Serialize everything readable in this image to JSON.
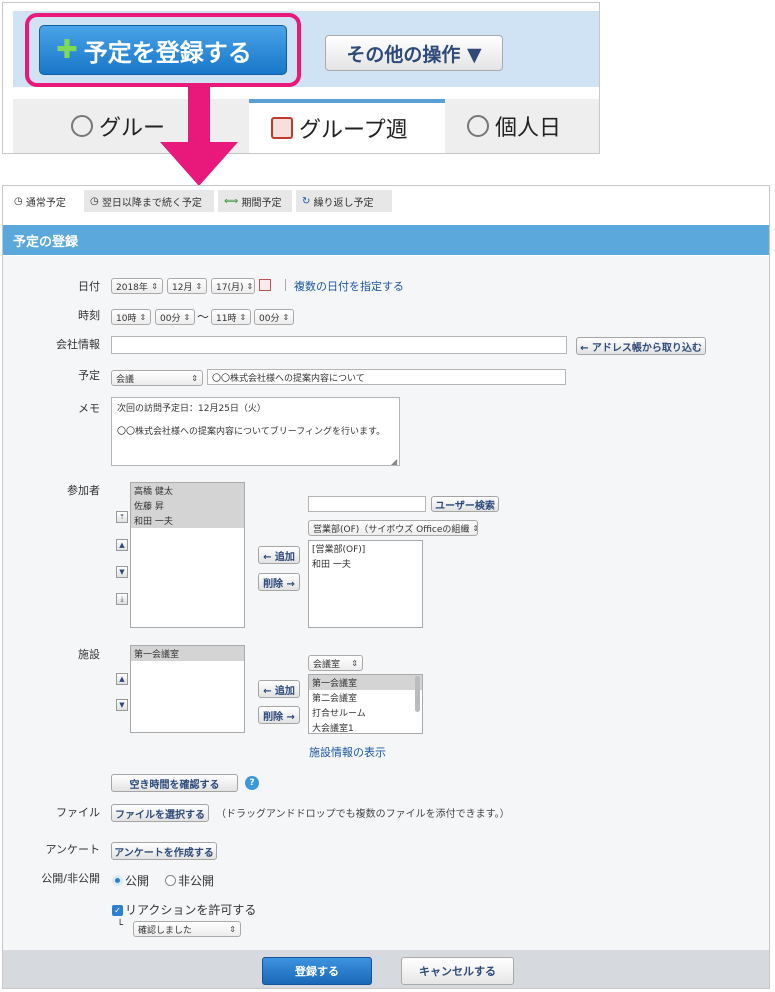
{
  "top": {
    "register_button": "予定を登録する",
    "other_ops": "その他の操作 ▼",
    "tabs": [
      "グルー",
      "グループ週",
      "個人日"
    ]
  },
  "subtabs": [
    "通常予定",
    "翌日以降まで続く予定",
    "期間予定",
    "繰り返し予定"
  ],
  "header": "予定の登録",
  "labels": {
    "date": "日付",
    "time": "時刻",
    "company": "会社情報",
    "plan": "予定",
    "memo": "メモ",
    "participants": "参加者",
    "facility": "施設",
    "file": "ファイル",
    "survey": "アンケート",
    "visibility": "公開/非公開"
  },
  "date": {
    "year": "2018年",
    "month": "12月",
    "day": "17(月)",
    "multi_link": "複数の日付を指定する"
  },
  "time": {
    "start_h": "10時",
    "start_m": "00分",
    "tilde": "〜",
    "end_h": "11時",
    "end_m": "00分"
  },
  "company": {
    "value": "",
    "addr_button": "← アドレス帳から取り込む"
  },
  "plan": {
    "type": "会議",
    "title": "〇〇株式会社様への提案内容について"
  },
  "memo": {
    "line1": "次回の訪問予定日：12月25日（火）",
    "line2": "〇〇株式会社様への提案内容についてブリーフィングを行います。"
  },
  "participants": {
    "selected": [
      "高橋 健太",
      "佐藤 昇",
      "和田 一夫"
    ],
    "search_value": "",
    "search_button": "ユーザー検索",
    "group_select": "営業部(OF)（サイボウズ Officeの組織",
    "candidates": [
      "[営業部(OF)]",
      "和田 一夫"
    ],
    "add_button": "← 追加",
    "remove_button": "削除 →"
  },
  "facility": {
    "selected": [
      "第一会議室"
    ],
    "group_select": "会議室",
    "candidates": [
      "第一会議室",
      "第二会議室",
      "打合せルーム",
      "大会議室1"
    ],
    "add_button": "← 追加",
    "remove_button": "削除 →",
    "info_link": "施設情報の表示"
  },
  "availability_button": "空き時間を確認する",
  "file": {
    "button": "ファイルを選択する",
    "hint": "（ドラッグアンドドロップでも複数のファイルを添付できます。）"
  },
  "survey_button": "アンケートを作成する",
  "visibility": {
    "public": "公開",
    "private": "非公開"
  },
  "reaction": {
    "label": "リアクションを許可する",
    "select": "確認しました",
    "tree": "└"
  },
  "footer": {
    "register": "登録する",
    "cancel": "キャンセルする"
  },
  "colors": {
    "accent": "#e8197a",
    "header": "#5aa8dc",
    "primary_btn": "#1d72c6"
  }
}
